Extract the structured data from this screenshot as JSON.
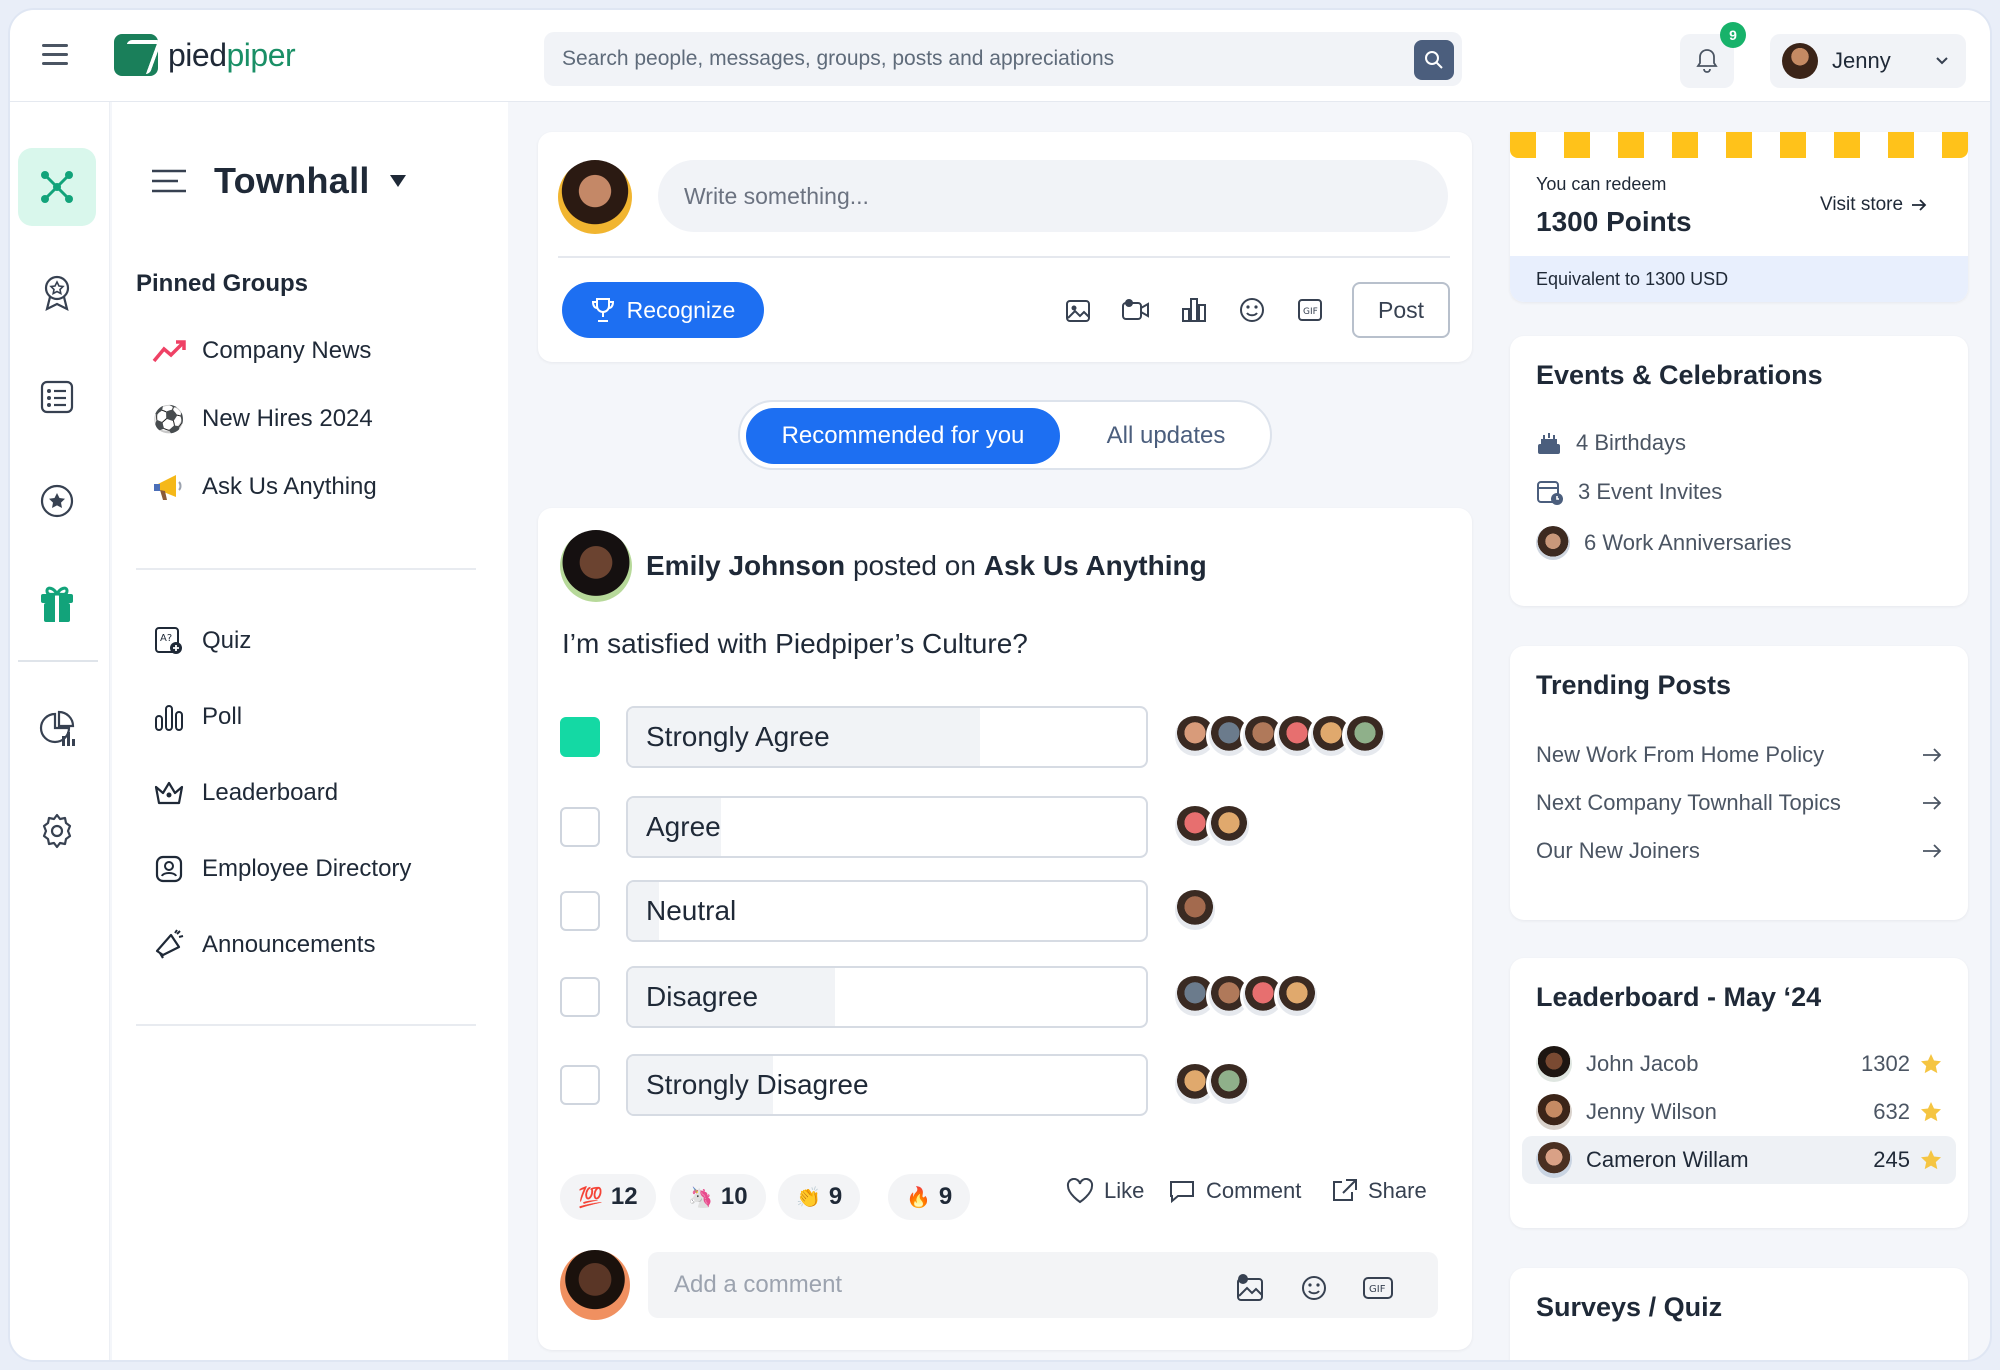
{
  "header": {
    "logo_text_1": "pied",
    "logo_text_2": "piper",
    "search_placeholder": "Search people, messages, groups, posts and appreciations",
    "notification_count": "9",
    "user_name": "Jenny"
  },
  "sidebar": {
    "title": "Townhall",
    "pinned_heading": "Pinned Groups",
    "pinned": [
      {
        "label": "Company News",
        "icon": "trending-up-icon"
      },
      {
        "label": "New Hires 2024",
        "icon": "soccer-ball-icon"
      },
      {
        "label": "Ask Us Anything",
        "icon": "megaphone-icon"
      }
    ],
    "tools": [
      {
        "label": "Quiz",
        "icon": "quiz-icon"
      },
      {
        "label": "Poll",
        "icon": "poll-icon"
      },
      {
        "label": "Leaderboard",
        "icon": "crown-icon"
      },
      {
        "label": "Employee Directory",
        "icon": "directory-icon"
      },
      {
        "label": "Announcements",
        "icon": "announcement-icon"
      }
    ]
  },
  "composer": {
    "placeholder": "Write something...",
    "recognize_label": "Recognize",
    "post_label": "Post"
  },
  "feed_toggle": {
    "active": "Recommended for you",
    "inactive": "All updates"
  },
  "post": {
    "author": "Emily Johnson",
    "verb": "posted on",
    "group": "Ask Us Anything",
    "question": "I’m satisfied with Piedpiper’s Culture?",
    "options": [
      {
        "label": "Strongly Agree",
        "fill_percent": 68,
        "checked": true,
        "voters": 6
      },
      {
        "label": "Agree",
        "fill_percent": 18,
        "checked": false,
        "voters": 2
      },
      {
        "label": "Neutral",
        "fill_percent": 6,
        "checked": false,
        "voters": 1
      },
      {
        "label": "Disagree",
        "fill_percent": 40,
        "checked": false,
        "voters": 4
      },
      {
        "label": "Strongly Disagree",
        "fill_percent": 28,
        "checked": false,
        "voters": 2
      }
    ],
    "reactions": [
      {
        "emoji": "💯",
        "count": "12"
      },
      {
        "emoji": "🦄",
        "count": "10"
      },
      {
        "emoji": "👏",
        "count": "9"
      },
      {
        "emoji": "🔥",
        "count": "9"
      }
    ],
    "like_label": "Like",
    "comment_label": "Comment",
    "share_label": "Share",
    "comment_placeholder": "Add a comment"
  },
  "redeem": {
    "small": "You can redeem",
    "points": "1300 Points",
    "visit": "Visit store",
    "equivalent": "Equivalent to 1300 USD"
  },
  "events": {
    "title": "Events & Celebrations",
    "items": [
      "4 Birthdays",
      "3 Event Invites",
      "6 Work Anniversaries"
    ]
  },
  "trending": {
    "title": "Trending Posts",
    "items": [
      "New Work From Home Policy",
      "Next Company Townhall Topics",
      "Our New Joiners"
    ]
  },
  "leaderboard": {
    "title": "Leaderboard - May ‘24",
    "items": [
      {
        "name": "John Jacob",
        "score": "1302"
      },
      {
        "name": "Jenny Wilson",
        "score": "632"
      },
      {
        "name": "Cameron Willam",
        "score": "245"
      }
    ]
  },
  "surveys": {
    "title": "Surveys / Quiz"
  },
  "colors": {
    "primary": "#1d6ff2",
    "accent_green": "#14d9a4",
    "brand_green": "#1a8f66",
    "star": "#f5c542"
  }
}
